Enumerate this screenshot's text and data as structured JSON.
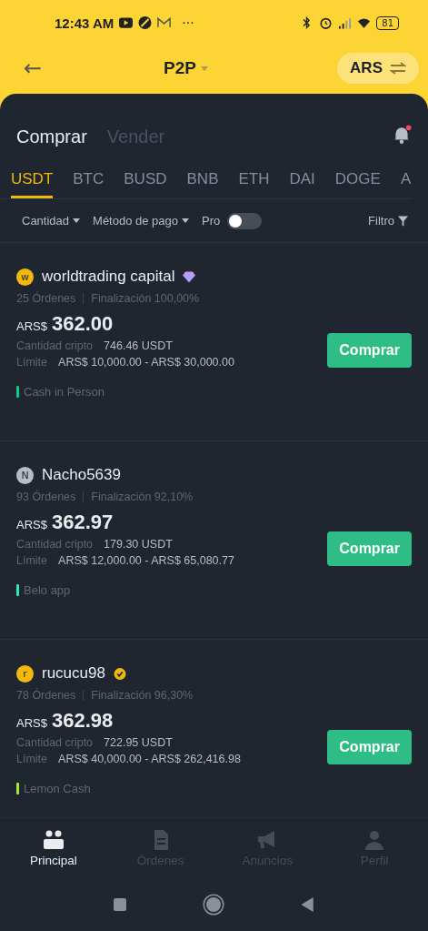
{
  "status_bar": {
    "time": "12:43 AM",
    "more": "···",
    "battery": "81"
  },
  "header": {
    "back": "←",
    "title": "P2P",
    "currency": "ARS"
  },
  "side_tabs": [
    {
      "label": "Comprar",
      "selected": true
    },
    {
      "label": "Vender",
      "selected": false
    }
  ],
  "notification": {
    "unread": true
  },
  "coins": [
    {
      "label": "USDT",
      "selected": true
    },
    {
      "label": "BTC",
      "selected": false
    },
    {
      "label": "BUSD",
      "selected": false
    },
    {
      "label": "BNB",
      "selected": false
    },
    {
      "label": "ETH",
      "selected": false
    },
    {
      "label": "DAI",
      "selected": false
    },
    {
      "label": "DOGE",
      "selected": false
    },
    {
      "label": "A",
      "selected": false
    }
  ],
  "filters": {
    "amount": "Cantidad",
    "payment": "Método de pago",
    "pro": {
      "label": "Pro",
      "on": false
    },
    "filter": "Filtro"
  },
  "offers": [
    {
      "avatar": {
        "letter": "w",
        "kind": "yellow"
      },
      "name": "worldtrading capital",
      "badge": {
        "kind": "diamond"
      },
      "orders": "25 Órdenes",
      "completion": "Finalización 100,00%",
      "currency": "ARS$",
      "price": "362.00",
      "amount_label": "Cantidad cripto",
      "amount": "746.46 USDT",
      "limit_label": "Límite",
      "limit": "ARS$ 10,000.00 - ARS$ 30,000.00",
      "button": "Comprar",
      "payment": "Cash in Person",
      "color": "#0ecb81"
    },
    {
      "avatar": {
        "letter": "N",
        "kind": "grey"
      },
      "name": "Nacho5639",
      "orders": "93 Órdenes",
      "completion": "Finalización 92,10%",
      "currency": "ARS$",
      "price": "362.97",
      "amount_label": "Cantidad cripto",
      "amount": "179.30 USDT",
      "limit_label": "Límite",
      "limit": "ARS$ 12,000.00 - ARS$ 65,080.77",
      "button": "Comprar",
      "payment": "Belo app",
      "color": "#2ee8b6"
    },
    {
      "avatar": {
        "letter": "r",
        "kind": "yellow"
      },
      "name": "rucucu98",
      "badge": {
        "kind": "verified"
      },
      "orders": "78 Órdenes",
      "completion": "Finalización 96,30%",
      "currency": "ARS$",
      "price": "362.98",
      "amount_label": "Cantidad cripto",
      "amount": "722.95 USDT",
      "limit_label": "Límite",
      "limit": "ARS$ 40,000.00 - ARS$ 262,416.98",
      "button": "Comprar",
      "payment": "Lemon Cash",
      "color": "#a3e635"
    }
  ],
  "nav": [
    {
      "label": "Principal",
      "kind": "home",
      "selected": true
    },
    {
      "label": "Órdenes",
      "kind": "doc",
      "selected": false
    },
    {
      "label": "Anuncios",
      "kind": "megaphone",
      "selected": false
    },
    {
      "label": "Perfil",
      "kind": "person",
      "selected": false
    }
  ]
}
